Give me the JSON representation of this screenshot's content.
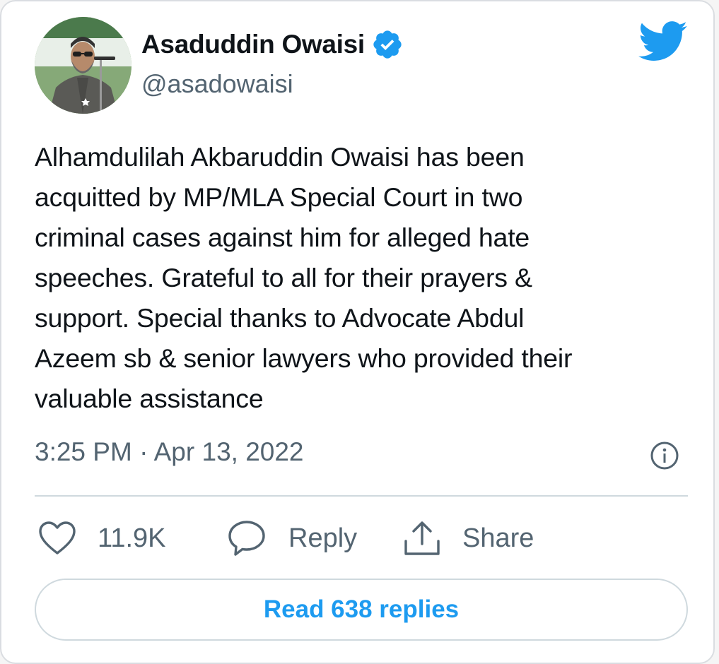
{
  "author": {
    "name": "Asaduddin Owaisi",
    "handle": "@asadowaisi",
    "verified": true
  },
  "tweet": {
    "text": "Alhamdulilah Akbaruddin Owaisi has been\nacquitted by MP/MLA Special Court in two\ncriminal cases against him for alleged hate\nspeeches. Grateful to all for their prayers &\nsupport. Special thanks to Advocate Abdul\nAzeem sb & senior lawyers who provided their\nvaluable assistance",
    "timestamp": "3:25 PM · Apr 13, 2022"
  },
  "actions": {
    "like_count": "11.9K",
    "reply_label": "Reply",
    "share_label": "Share"
  },
  "read_replies_label": "Read 638 replies",
  "colors": {
    "accent": "#1d9bf0",
    "text_primary": "#0f1419",
    "text_secondary": "#536471",
    "border": "#cfd9de"
  },
  "icons": {
    "logo": "twitter-bird-icon",
    "verified": "verified-badge-icon",
    "info": "info-icon",
    "like": "heart-icon",
    "reply": "speech-bubble-icon",
    "share": "share-upload-icon"
  }
}
